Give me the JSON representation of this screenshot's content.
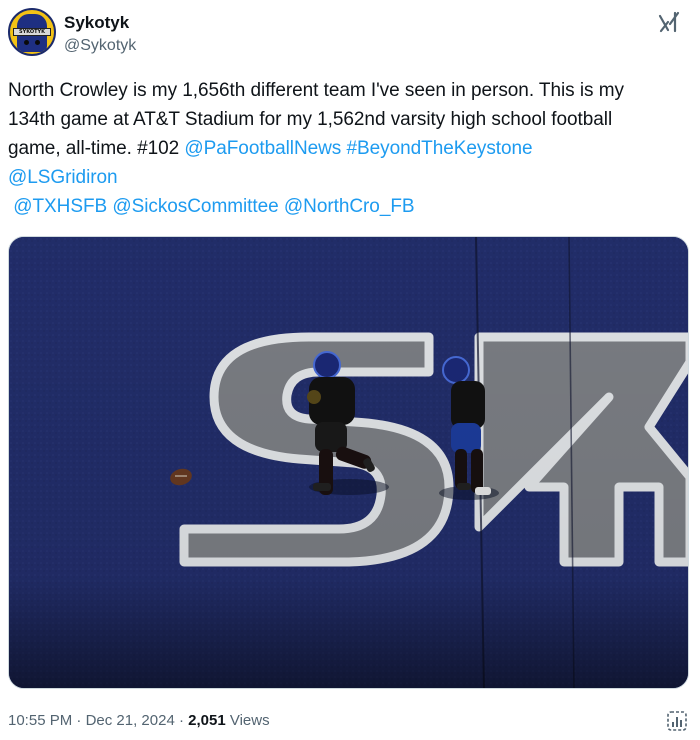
{
  "author": {
    "display_name": "Sykotyk",
    "handle": "@Sykotyk",
    "avatar_band_text": "SYKOTYK"
  },
  "tweet": {
    "line1": "North Crowley is my 1,656th different team I've seen in person. This is my",
    "line2": "134th game at AT&T Stadium for my 1,562nd varsity high school football",
    "line3_text": "game, all-time. #102 ",
    "mentions": {
      "pafootballnews": "@PaFootballNews",
      "beyondthekeystone": "#BeyondTheKeystone",
      "lsgridiron": "@LSGridiron",
      "txhsfb": "@TXHSFB",
      "sickoscommittee": "@SickosCommittee",
      "northcro": "@NorthCro_FB"
    }
  },
  "meta": {
    "time": "10:55 PM",
    "separator": "·",
    "date": "Dec 21, 2024",
    "views_count": "2,051",
    "views_label": "Views"
  },
  "colors": {
    "link": "#1d9bf0",
    "text": "#0f1419",
    "secondary": "#536471",
    "turf": "#1f2a66"
  },
  "icons": {
    "grok": "grok-icon",
    "analytics": "analytics-icon"
  }
}
